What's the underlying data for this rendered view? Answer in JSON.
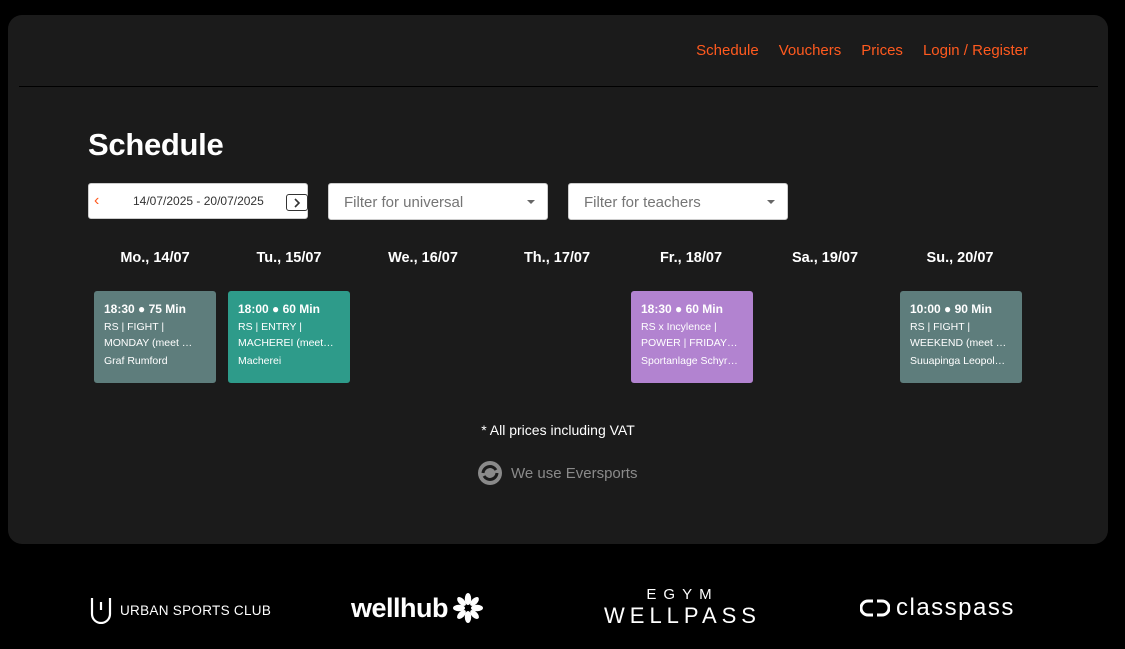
{
  "nav": {
    "items": [
      {
        "label": "Schedule"
      },
      {
        "label": "Vouchers"
      },
      {
        "label": "Prices"
      },
      {
        "label": "Login / Register"
      }
    ]
  },
  "page": {
    "title": "Schedule"
  },
  "filters": {
    "date_range": "14/07/2025 - 20/07/2025",
    "universal_placeholder": "Filter for universal",
    "teachers_placeholder": "Filter for teachers"
  },
  "days": [
    {
      "label": "Mo., 14/07"
    },
    {
      "label": "Tu., 15/07"
    },
    {
      "label": "We., 16/07"
    },
    {
      "label": "Th., 17/07"
    },
    {
      "label": "Fr., 18/07"
    },
    {
      "label": "Sa., 19/07"
    },
    {
      "label": "Su., 20/07"
    }
  ],
  "events": [
    {
      "time": "18:30 ● 75 Min",
      "title": "RS | FIGHT | MONDAY (meet …",
      "location": "Graf Rumford",
      "color": "#5e7d7c"
    },
    {
      "time": "18:00 ● 60 Min",
      "title": "RS | ENTRY | MACHEREI (meet…",
      "location": "Macherei",
      "color": "#2e9b8a"
    },
    {
      "time": "18:30 ● 60 Min",
      "title": "RS x Incylence | POWER | FRIDAY…",
      "location": "Sportanlage Schyr…",
      "color": "#b283d0"
    },
    {
      "time": "10:00 ● 90 Min",
      "title": "RS | FIGHT | WEEKEND (meet …",
      "location": "Suuapinga Leopol…",
      "color": "#5e7d7c"
    }
  ],
  "footer": {
    "vat_note": "* All prices including VAT",
    "powered_by": "We use Eversports"
  },
  "partners": {
    "usc": "URBAN SPORTS CLUB",
    "wellhub": "wellhub",
    "egym_top": "EGYM",
    "egym_bottom": "WELLPASS",
    "classpass": "classpass"
  },
  "colors": {
    "accent": "#ff5a1f",
    "panel": "#1b1b1b",
    "background": "#000000"
  }
}
